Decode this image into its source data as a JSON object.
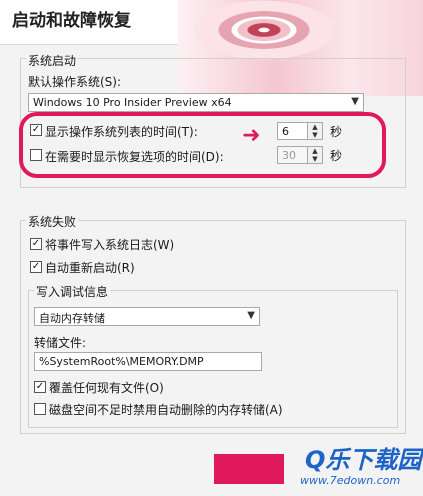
{
  "window": {
    "title": "启动和故障恢复"
  },
  "system_startup": {
    "group_label": "系统启动",
    "default_os_label": "默认操作系统(S):",
    "default_os_value": "Windows 10 Pro Insider Preview x64",
    "show_list_label": "显示操作系统列表的时间(T):",
    "show_list_checked": true,
    "show_list_value": "6",
    "show_recovery_label": "在需要时显示恢复选项的时间(D):",
    "show_recovery_checked": false,
    "show_recovery_value": "30",
    "seconds_unit": "秒"
  },
  "system_failure": {
    "group_label": "系统失败",
    "write_event_label": "将事件写入系统日志(W)",
    "write_event_checked": true,
    "auto_restart_label": "自动重新启动(R)",
    "auto_restart_checked": true,
    "debug_group_label": "写入调试信息",
    "debug_type_value": "自动内存转储",
    "dump_file_label": "转储文件:",
    "dump_file_value": "%SystemRoot%\\MEMORY.DMP",
    "overwrite_label": "覆盖任何现有文件(O)",
    "overwrite_checked": true,
    "disable_auto_delete_label": "磁盘空间不足时禁用自动删除的内存转储(A)",
    "disable_auto_delete_checked": false
  },
  "watermark": {
    "brand": "Q乐下载园",
    "url": "www.7edown.com"
  },
  "colors": {
    "highlight": "#e0195c",
    "watermark": "#1e64c8"
  }
}
